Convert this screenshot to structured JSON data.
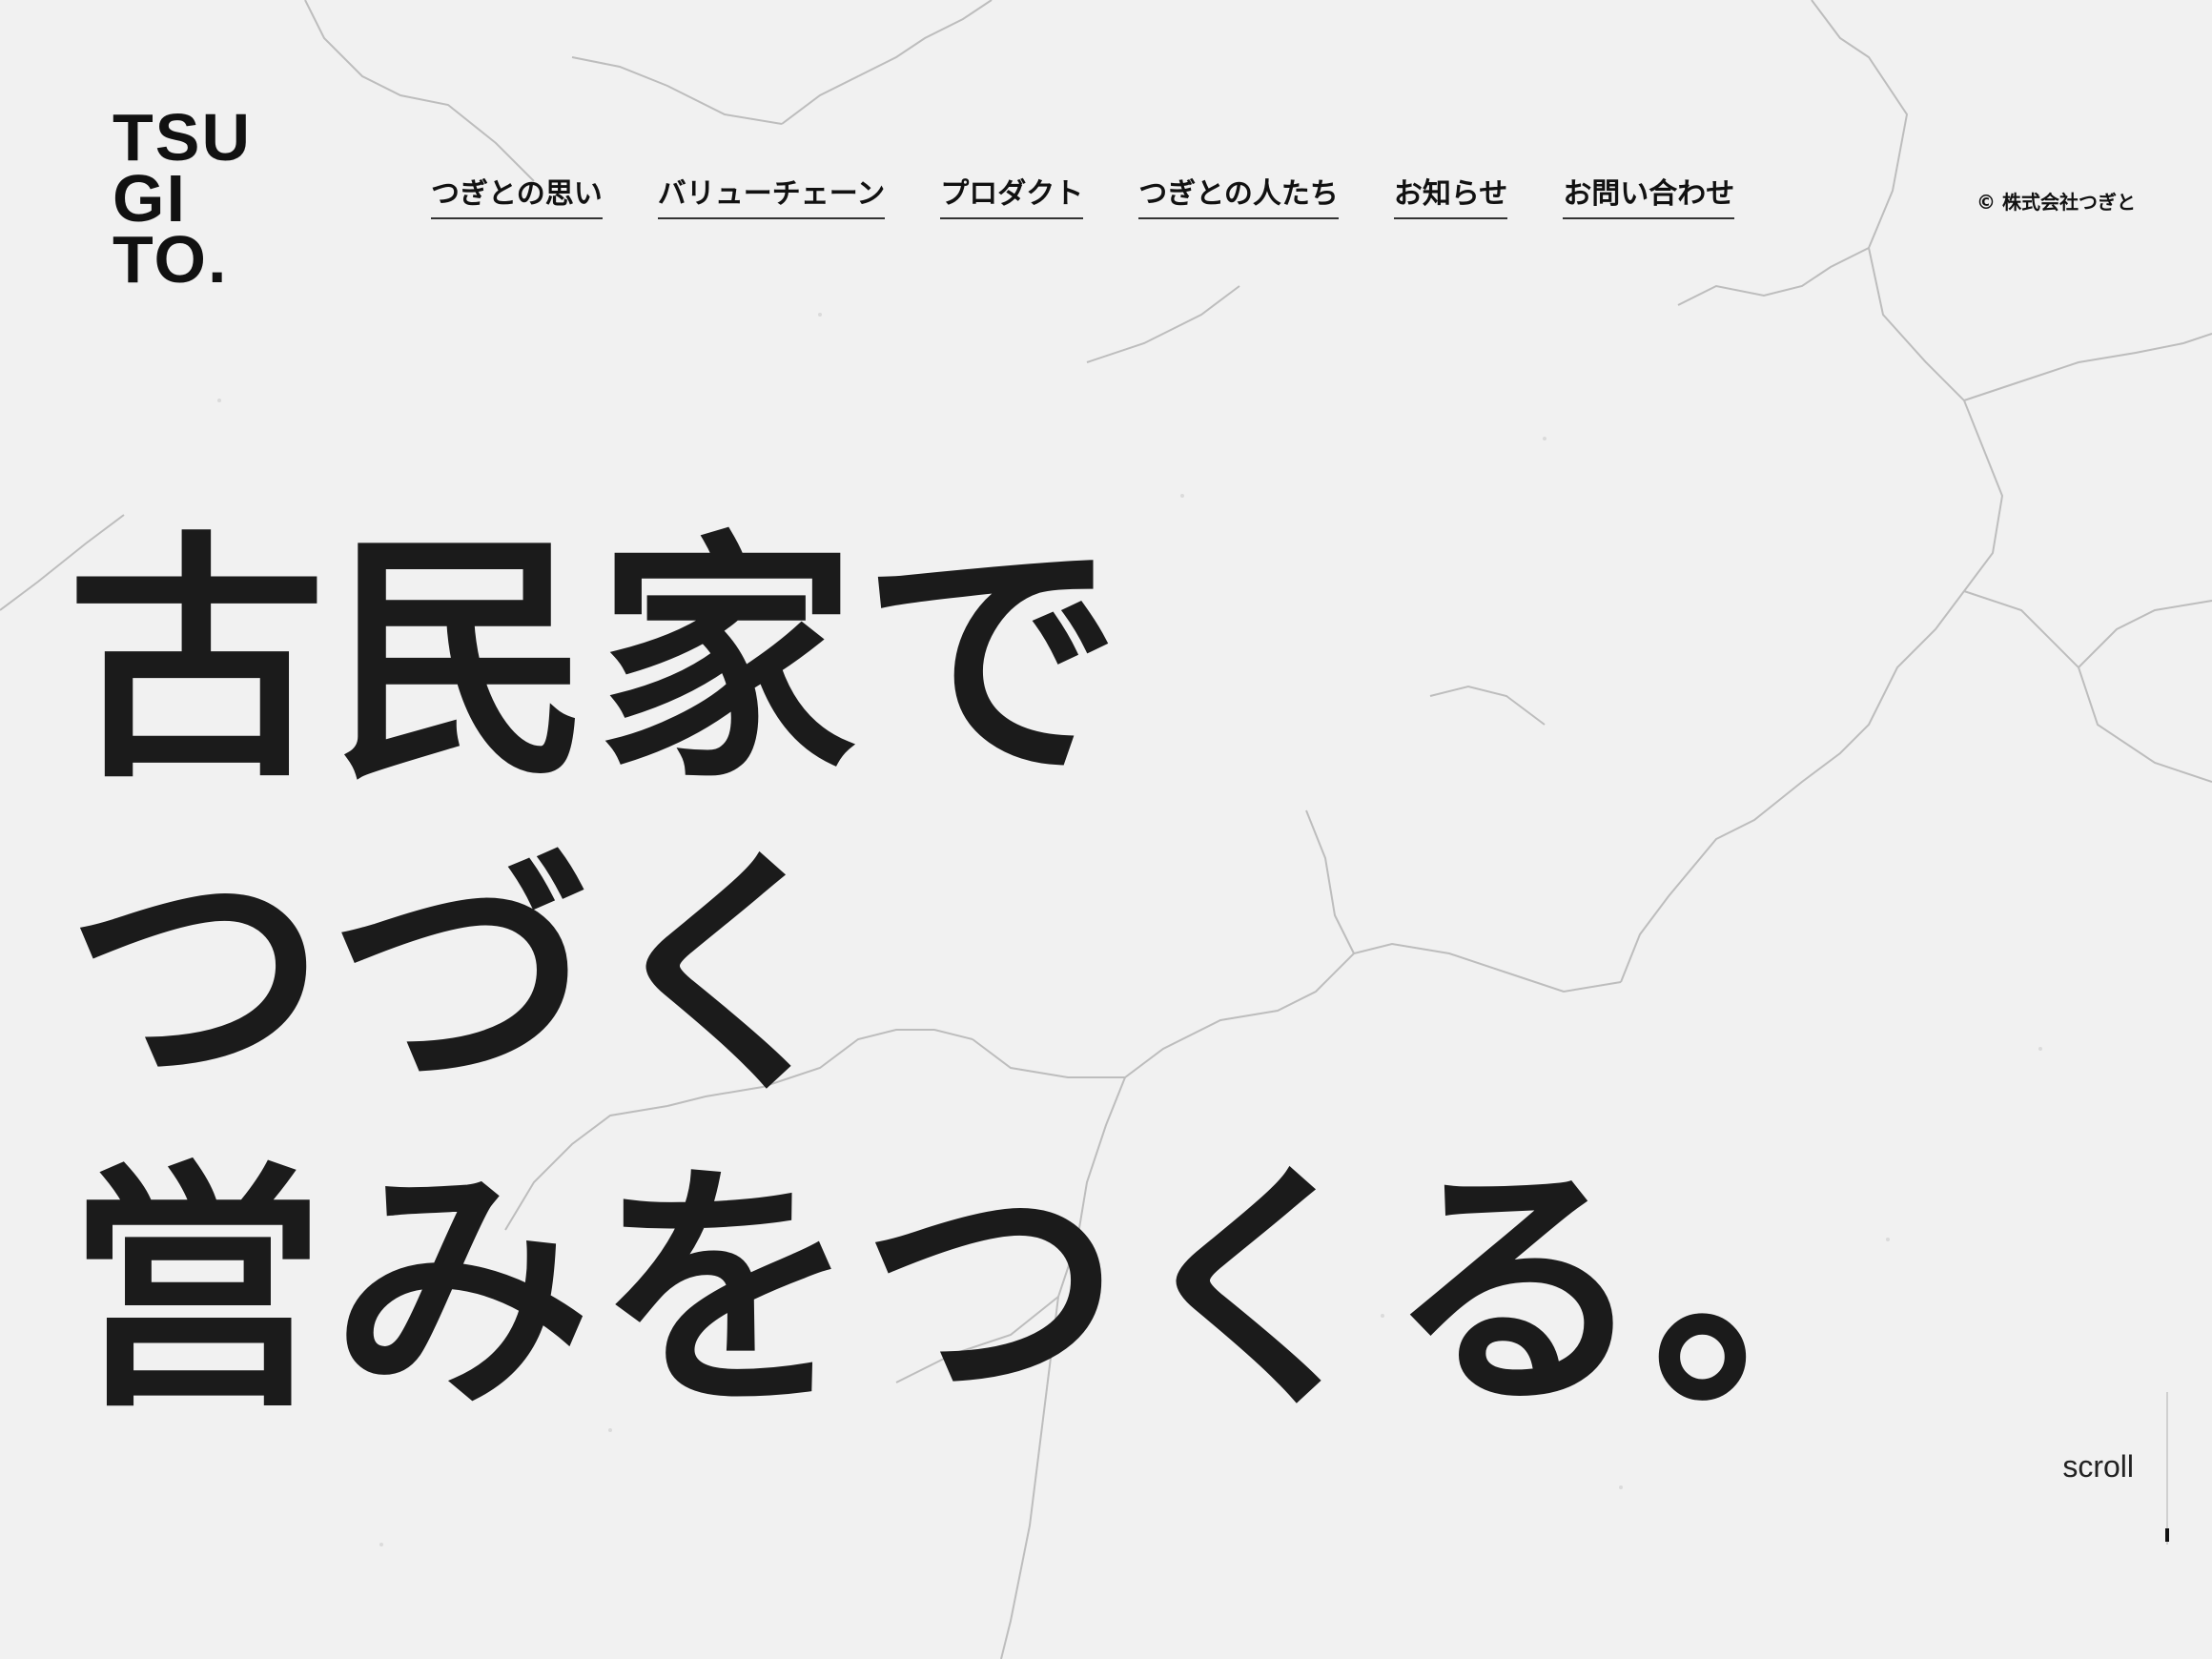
{
  "logo": {
    "line1": "TSU",
    "line2": "GI",
    "line3": "TO."
  },
  "nav": {
    "items": [
      {
        "label": "つぎとの思い"
      },
      {
        "label": "バリューチェーン"
      },
      {
        "label": "プロダクト"
      },
      {
        "label": "つぎとの人たち"
      },
      {
        "label": "お知らせ"
      },
      {
        "label": "お問い合わせ"
      }
    ]
  },
  "copyright": "© 株式会社つぎと",
  "hero": {
    "line1": "古民家で",
    "line2": "つづく",
    "line3": "営みをつくる。"
  },
  "scroll": {
    "label": "scroll"
  },
  "colors": {
    "background": "#f2f2f2",
    "text": "#1a1a1a",
    "crack": "#b9b9b9"
  }
}
